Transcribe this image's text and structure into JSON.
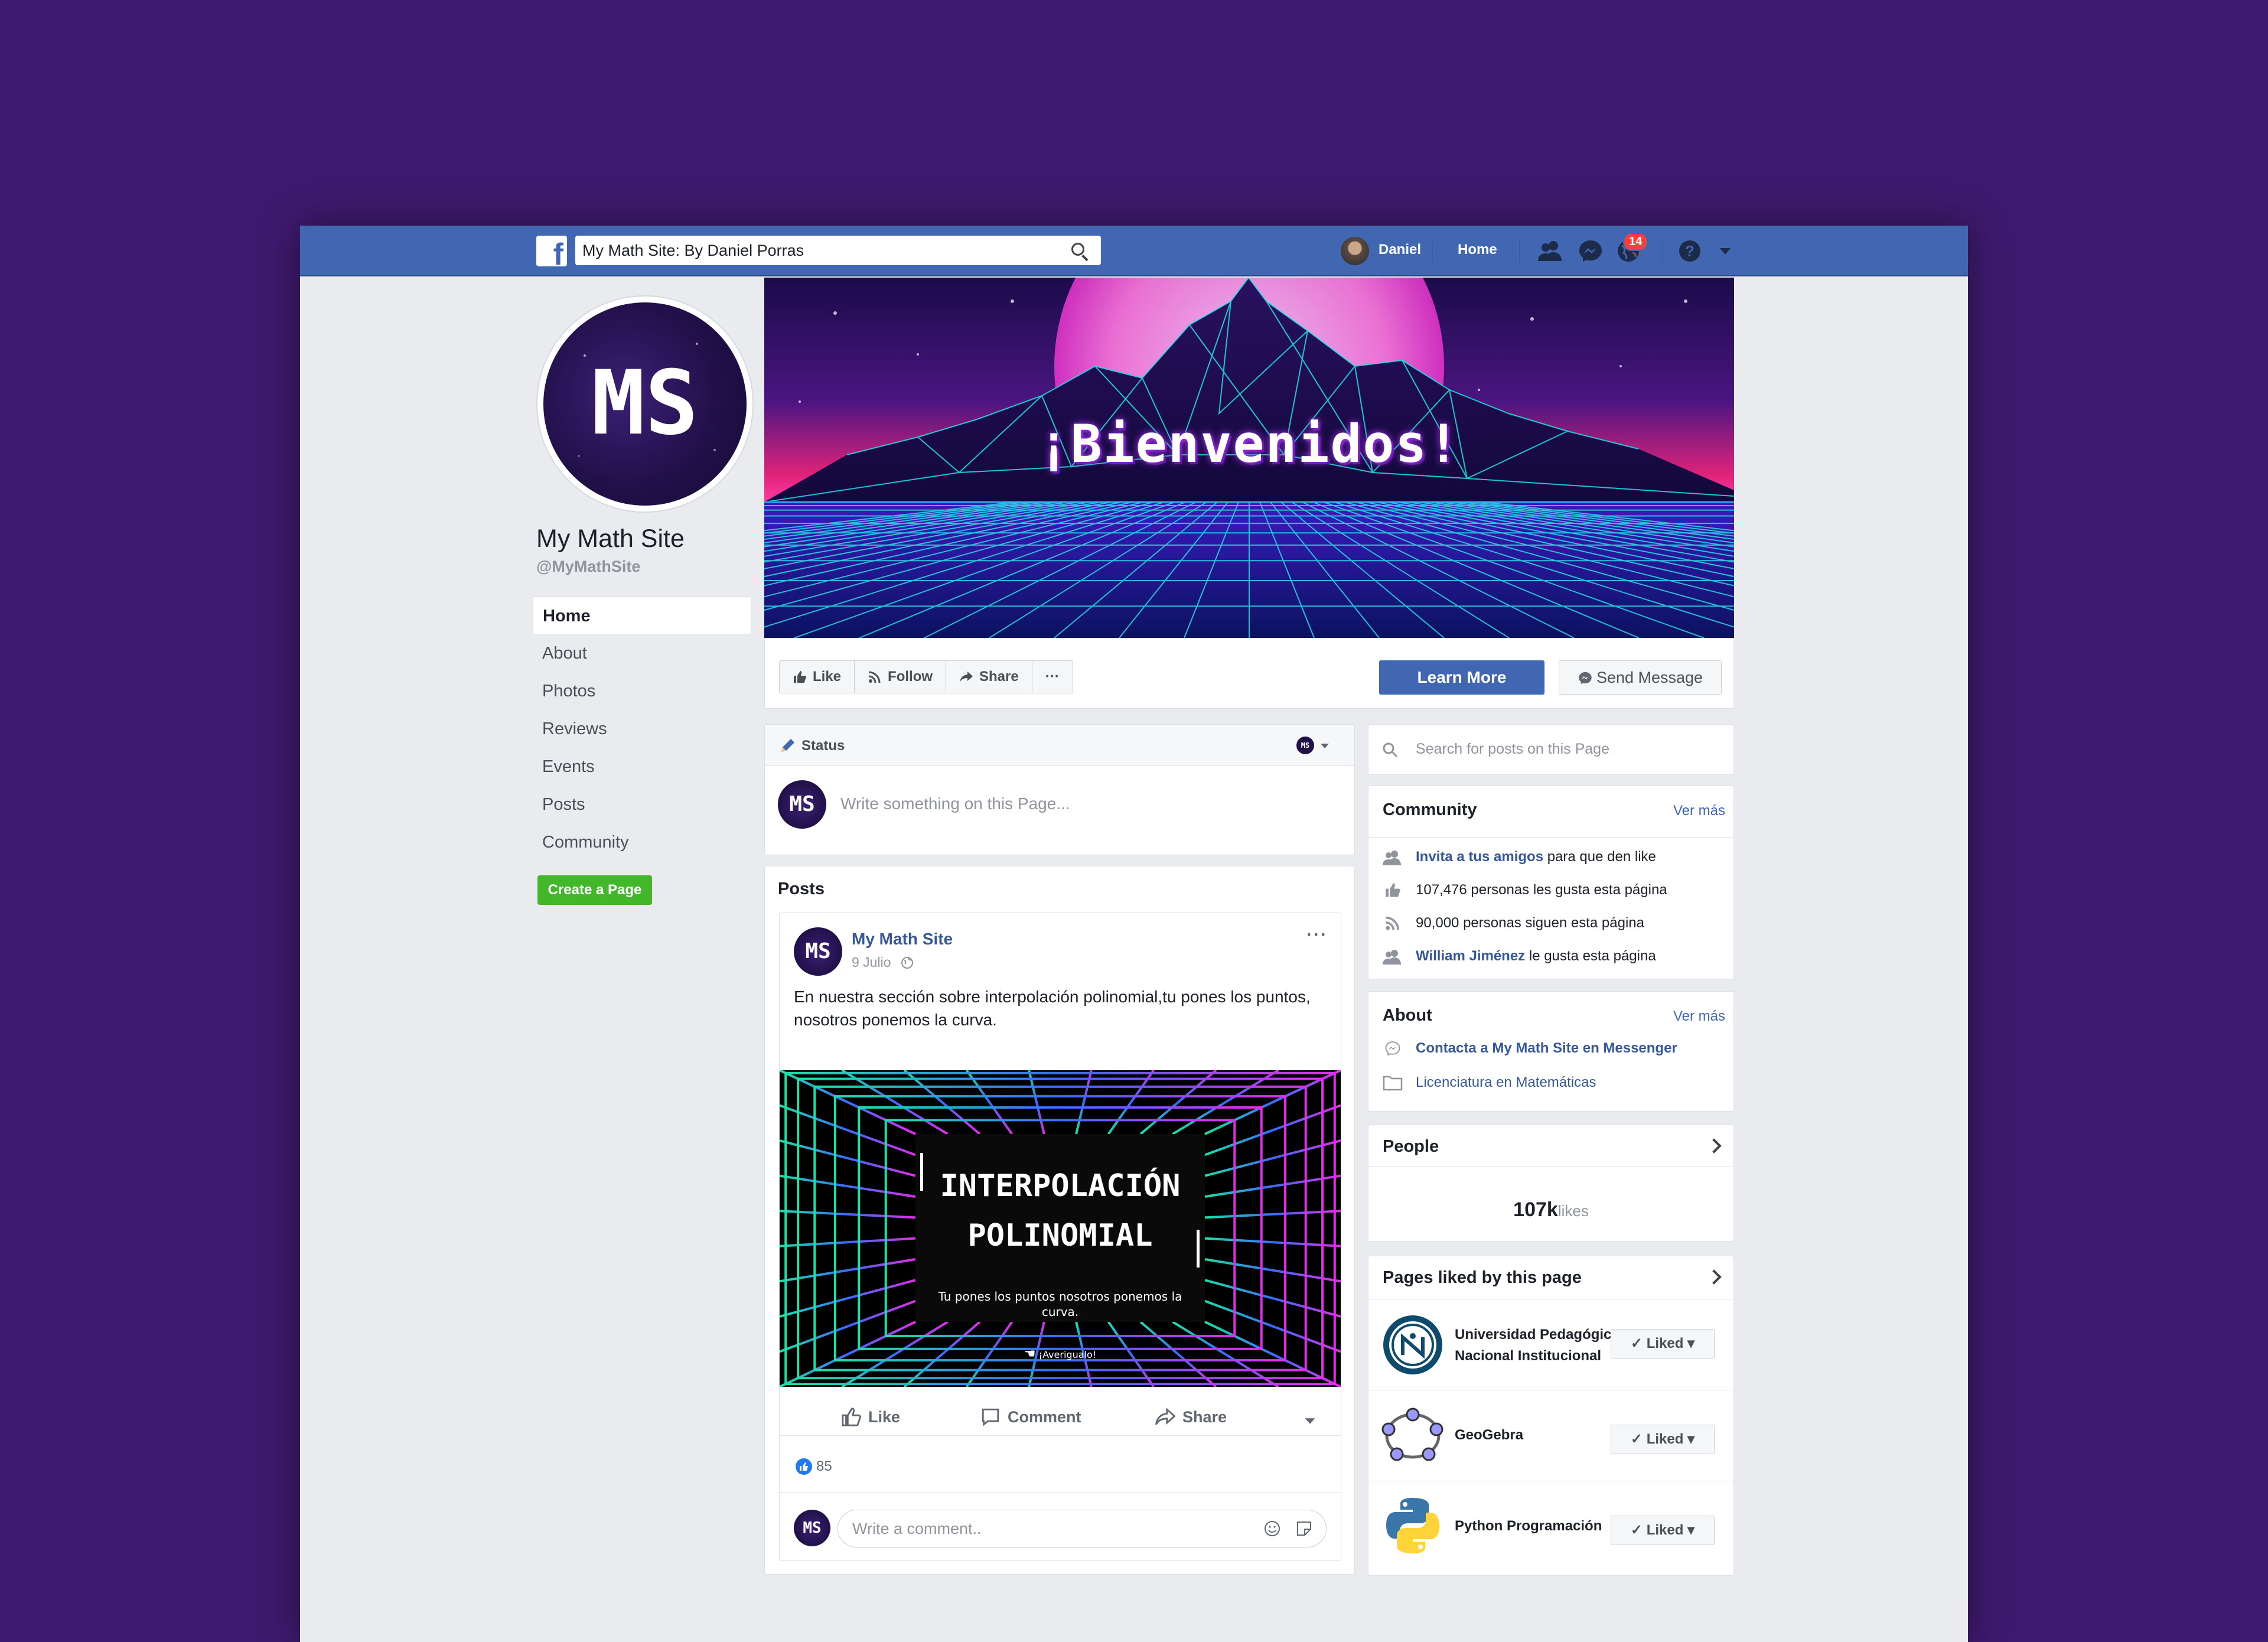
{
  "topbar": {
    "search_value": "My Math Site: By Daniel Porras",
    "user_name": "Daniel",
    "home_label": "Home",
    "notification_count": "14",
    "icons": [
      "facebook-logo",
      "search-icon",
      "friends-icon",
      "messenger-icon",
      "globe-icon",
      "help-icon",
      "dropdown-icon"
    ]
  },
  "profile": {
    "monogram": "MS",
    "name": "My Math Site",
    "handle": "@MyMathSite"
  },
  "leftnav": {
    "items": [
      "Home",
      "About",
      "Photos",
      "Reviews",
      "Events",
      "Posts",
      "Community"
    ],
    "active": "Home",
    "create_page": "Create a Page"
  },
  "cover": {
    "title": "¡Bienvenidos!"
  },
  "actions": {
    "like": "Like",
    "follow": "Follow",
    "share": "Share",
    "more": "···",
    "learn_more": "Learn More",
    "send_message": "Send Message"
  },
  "status": {
    "label": "Status",
    "placeholder": "Write something on this Page..."
  },
  "posts": {
    "title": "Posts",
    "post": {
      "author": "My Math Site",
      "date": "9 Julio",
      "text": "En nuestra sección sobre interpolación polinomial,tu pones los puntos, nosotros ponemos la curva.",
      "image_title_1": "INTERPOLACIÓN",
      "image_title_2": "POLINOMIAL",
      "image_subtitle": "Tu pones los puntos nosotros ponemos la curva.",
      "image_cta": "¡Averigualo!",
      "like": "Like",
      "comment": "Comment",
      "share": "Share",
      "reactions": "85",
      "comment_placeholder": "Write a comment.."
    }
  },
  "sidebar": {
    "search_placeholder": "Search for posts on this Page",
    "community": {
      "title": "Community",
      "ver_mas": "Ver más",
      "invite_link": "Invita a tus amigos",
      "invite_rest": " para que den like",
      "likes_text": "107,476 personas les gusta esta página",
      "follows_text": "90,000 personas siguen esta página",
      "friend_link": "William Jiménez",
      "friend_rest": " le gusta esta página"
    },
    "about": {
      "title": "About",
      "ver_mas": "Ver más",
      "messenger": "Contacta a My Math Site en Messenger",
      "degree": "Licenciatura en Matemáticas"
    },
    "people": {
      "title": "People",
      "count": "107k",
      "count_label": "likes"
    },
    "pages_liked": {
      "title": "Pages liked by this page",
      "items": [
        {
          "name_1": "Universidad Pedagógica",
          "name_2": "Nacional Institucional",
          "button": "Liked"
        },
        {
          "name_1": "GeoGebra",
          "button": "Liked"
        },
        {
          "name_1": "Python Programación",
          "button": "Liked"
        }
      ]
    }
  },
  "colors": {
    "brand": "#4267b2",
    "page_bg": "#3e1a6e",
    "create_green": "#42b72a",
    "link": "#365899"
  }
}
